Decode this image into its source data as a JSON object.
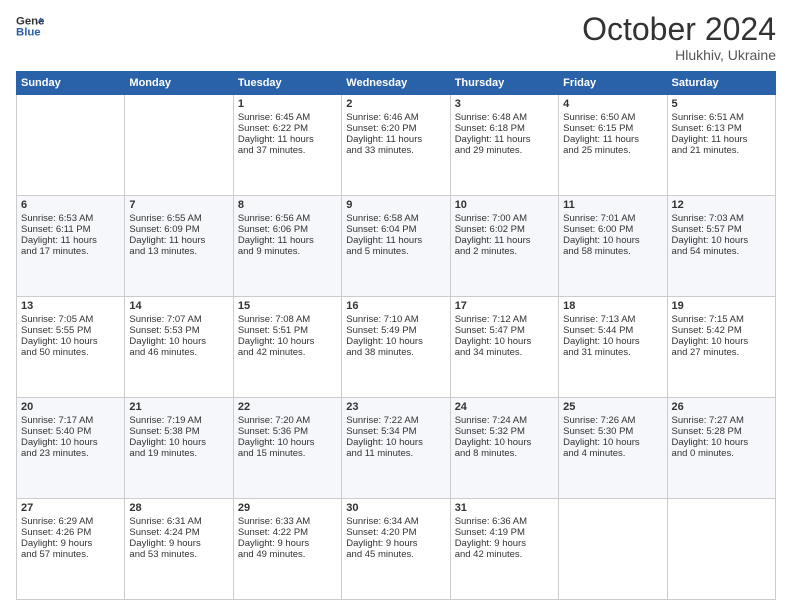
{
  "logo": {
    "line1": "General",
    "line2": "Blue"
  },
  "header": {
    "month": "October 2024",
    "location": "Hlukhiv, Ukraine"
  },
  "weekdays": [
    "Sunday",
    "Monday",
    "Tuesday",
    "Wednesday",
    "Thursday",
    "Friday",
    "Saturday"
  ],
  "weeks": [
    [
      {
        "day": "",
        "lines": []
      },
      {
        "day": "",
        "lines": []
      },
      {
        "day": "1",
        "lines": [
          "Sunrise: 6:45 AM",
          "Sunset: 6:22 PM",
          "Daylight: 11 hours",
          "and 37 minutes."
        ]
      },
      {
        "day": "2",
        "lines": [
          "Sunrise: 6:46 AM",
          "Sunset: 6:20 PM",
          "Daylight: 11 hours",
          "and 33 minutes."
        ]
      },
      {
        "day": "3",
        "lines": [
          "Sunrise: 6:48 AM",
          "Sunset: 6:18 PM",
          "Daylight: 11 hours",
          "and 29 minutes."
        ]
      },
      {
        "day": "4",
        "lines": [
          "Sunrise: 6:50 AM",
          "Sunset: 6:15 PM",
          "Daylight: 11 hours",
          "and 25 minutes."
        ]
      },
      {
        "day": "5",
        "lines": [
          "Sunrise: 6:51 AM",
          "Sunset: 6:13 PM",
          "Daylight: 11 hours",
          "and 21 minutes."
        ]
      }
    ],
    [
      {
        "day": "6",
        "lines": [
          "Sunrise: 6:53 AM",
          "Sunset: 6:11 PM",
          "Daylight: 11 hours",
          "and 17 minutes."
        ]
      },
      {
        "day": "7",
        "lines": [
          "Sunrise: 6:55 AM",
          "Sunset: 6:09 PM",
          "Daylight: 11 hours",
          "and 13 minutes."
        ]
      },
      {
        "day": "8",
        "lines": [
          "Sunrise: 6:56 AM",
          "Sunset: 6:06 PM",
          "Daylight: 11 hours",
          "and 9 minutes."
        ]
      },
      {
        "day": "9",
        "lines": [
          "Sunrise: 6:58 AM",
          "Sunset: 6:04 PM",
          "Daylight: 11 hours",
          "and 5 minutes."
        ]
      },
      {
        "day": "10",
        "lines": [
          "Sunrise: 7:00 AM",
          "Sunset: 6:02 PM",
          "Daylight: 11 hours",
          "and 2 minutes."
        ]
      },
      {
        "day": "11",
        "lines": [
          "Sunrise: 7:01 AM",
          "Sunset: 6:00 PM",
          "Daylight: 10 hours",
          "and 58 minutes."
        ]
      },
      {
        "day": "12",
        "lines": [
          "Sunrise: 7:03 AM",
          "Sunset: 5:57 PM",
          "Daylight: 10 hours",
          "and 54 minutes."
        ]
      }
    ],
    [
      {
        "day": "13",
        "lines": [
          "Sunrise: 7:05 AM",
          "Sunset: 5:55 PM",
          "Daylight: 10 hours",
          "and 50 minutes."
        ]
      },
      {
        "day": "14",
        "lines": [
          "Sunrise: 7:07 AM",
          "Sunset: 5:53 PM",
          "Daylight: 10 hours",
          "and 46 minutes."
        ]
      },
      {
        "day": "15",
        "lines": [
          "Sunrise: 7:08 AM",
          "Sunset: 5:51 PM",
          "Daylight: 10 hours",
          "and 42 minutes."
        ]
      },
      {
        "day": "16",
        "lines": [
          "Sunrise: 7:10 AM",
          "Sunset: 5:49 PM",
          "Daylight: 10 hours",
          "and 38 minutes."
        ]
      },
      {
        "day": "17",
        "lines": [
          "Sunrise: 7:12 AM",
          "Sunset: 5:47 PM",
          "Daylight: 10 hours",
          "and 34 minutes."
        ]
      },
      {
        "day": "18",
        "lines": [
          "Sunrise: 7:13 AM",
          "Sunset: 5:44 PM",
          "Daylight: 10 hours",
          "and 31 minutes."
        ]
      },
      {
        "day": "19",
        "lines": [
          "Sunrise: 7:15 AM",
          "Sunset: 5:42 PM",
          "Daylight: 10 hours",
          "and 27 minutes."
        ]
      }
    ],
    [
      {
        "day": "20",
        "lines": [
          "Sunrise: 7:17 AM",
          "Sunset: 5:40 PM",
          "Daylight: 10 hours",
          "and 23 minutes."
        ]
      },
      {
        "day": "21",
        "lines": [
          "Sunrise: 7:19 AM",
          "Sunset: 5:38 PM",
          "Daylight: 10 hours",
          "and 19 minutes."
        ]
      },
      {
        "day": "22",
        "lines": [
          "Sunrise: 7:20 AM",
          "Sunset: 5:36 PM",
          "Daylight: 10 hours",
          "and 15 minutes."
        ]
      },
      {
        "day": "23",
        "lines": [
          "Sunrise: 7:22 AM",
          "Sunset: 5:34 PM",
          "Daylight: 10 hours",
          "and 11 minutes."
        ]
      },
      {
        "day": "24",
        "lines": [
          "Sunrise: 7:24 AM",
          "Sunset: 5:32 PM",
          "Daylight: 10 hours",
          "and 8 minutes."
        ]
      },
      {
        "day": "25",
        "lines": [
          "Sunrise: 7:26 AM",
          "Sunset: 5:30 PM",
          "Daylight: 10 hours",
          "and 4 minutes."
        ]
      },
      {
        "day": "26",
        "lines": [
          "Sunrise: 7:27 AM",
          "Sunset: 5:28 PM",
          "Daylight: 10 hours",
          "and 0 minutes."
        ]
      }
    ],
    [
      {
        "day": "27",
        "lines": [
          "Sunrise: 6:29 AM",
          "Sunset: 4:26 PM",
          "Daylight: 9 hours",
          "and 57 minutes."
        ]
      },
      {
        "day": "28",
        "lines": [
          "Sunrise: 6:31 AM",
          "Sunset: 4:24 PM",
          "Daylight: 9 hours",
          "and 53 minutes."
        ]
      },
      {
        "day": "29",
        "lines": [
          "Sunrise: 6:33 AM",
          "Sunset: 4:22 PM",
          "Daylight: 9 hours",
          "and 49 minutes."
        ]
      },
      {
        "day": "30",
        "lines": [
          "Sunrise: 6:34 AM",
          "Sunset: 4:20 PM",
          "Daylight: 9 hours",
          "and 45 minutes."
        ]
      },
      {
        "day": "31",
        "lines": [
          "Sunrise: 6:36 AM",
          "Sunset: 4:19 PM",
          "Daylight: 9 hours",
          "and 42 minutes."
        ]
      },
      {
        "day": "",
        "lines": []
      },
      {
        "day": "",
        "lines": []
      }
    ]
  ]
}
